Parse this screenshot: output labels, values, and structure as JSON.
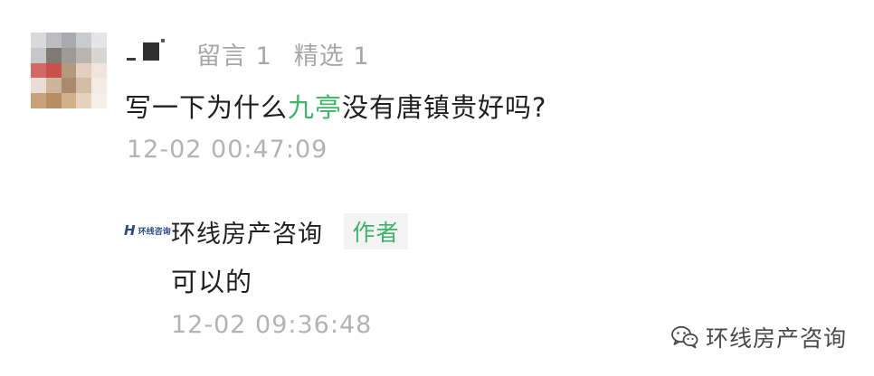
{
  "comment": {
    "author_name": "_",
    "likes_label": "留言 1",
    "featured_label": "精选 1",
    "text_before": "写一下为什么",
    "text_highlight": "九亭",
    "text_after": "没有唐镇贵好吗?",
    "timestamp": "12-02 00:47:09"
  },
  "reply": {
    "logo_text": "环线咨询",
    "author": "环线房产咨询",
    "author_tag": "作者",
    "text": "可以的",
    "timestamp": "12-02 09:36:48"
  },
  "watermark": {
    "text": "环线房产咨询"
  },
  "colors": {
    "accent_green": "#3eb36a",
    "muted_gray": "#b3b3b3",
    "text_dark": "#1f1f1f",
    "brand_blue": "#2b4a8b"
  }
}
